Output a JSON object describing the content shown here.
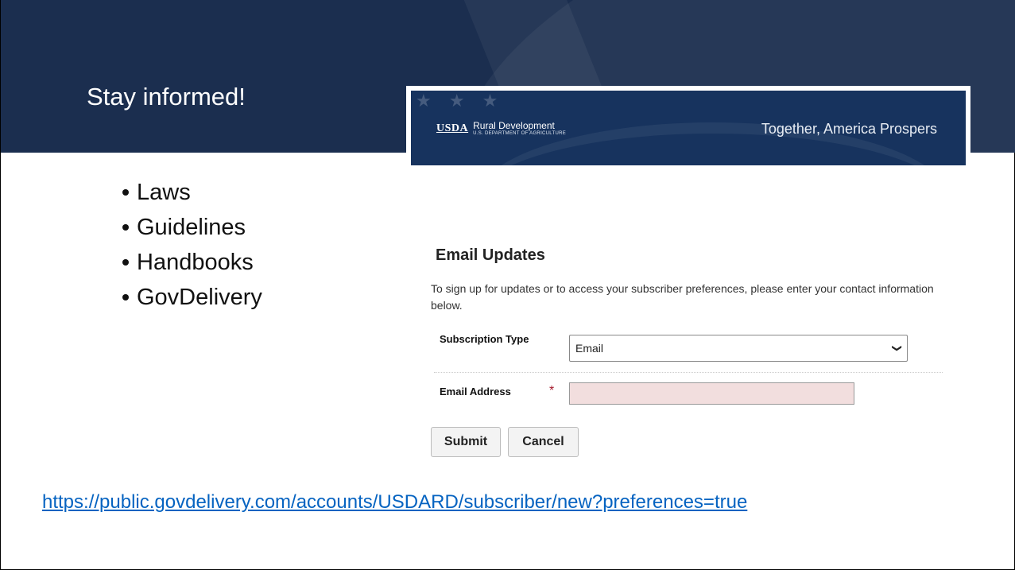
{
  "slide": {
    "title": "Stay informed!",
    "bullets": [
      "Laws",
      "Guidelines",
      "Handbooks",
      "GovDelivery"
    ],
    "link": "https://public.govdelivery.com/accounts/USDARD/subscriber/new?preferences=true"
  },
  "banner": {
    "logo_mark": "USDA",
    "agency": "Rural Development",
    "department": "U.S. DEPARTMENT OF AGRICULTURE",
    "tagline": "Together, America Prospers"
  },
  "form": {
    "heading": "Email Updates",
    "intro": "To sign up for updates or to access your subscriber preferences, please enter your contact information below.",
    "subscription_type_label": "Subscription Type",
    "subscription_type_value": "Email",
    "email_label": "Email Address",
    "required_marker": "*",
    "email_value": "",
    "submit_label": "Submit",
    "cancel_label": "Cancel"
  },
  "colors": {
    "header_bg": "#1b2e4f",
    "banner_bg": "#17335e",
    "required": "#a4182a",
    "email_field_bg": "#f2dede",
    "link": "#0563c1"
  }
}
